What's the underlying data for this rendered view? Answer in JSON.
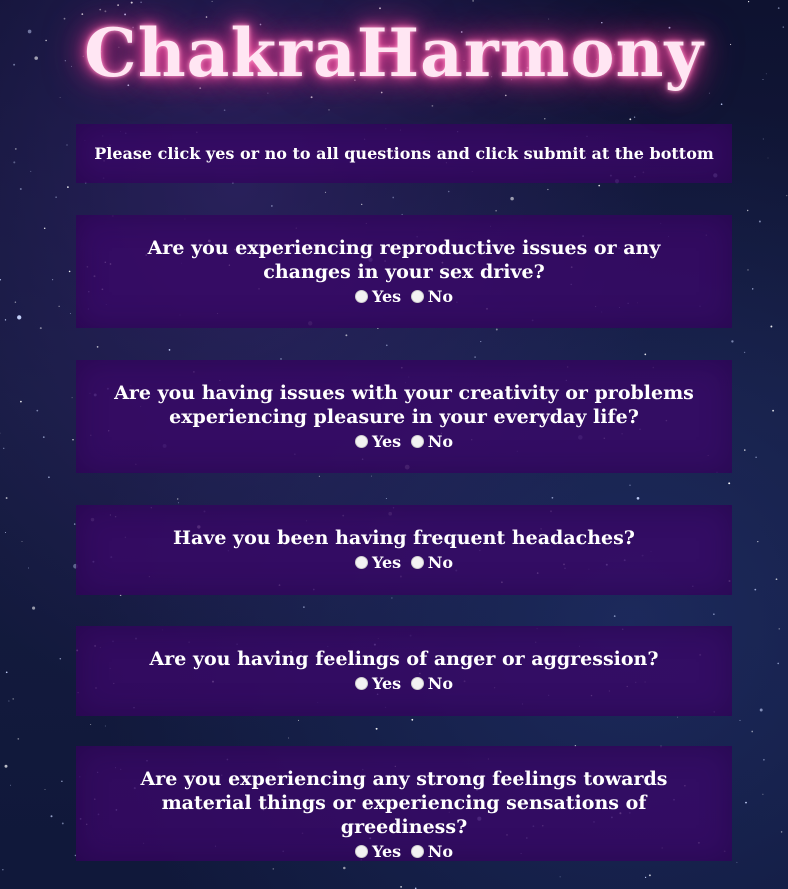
{
  "app": {
    "title": "ChakraHarmony",
    "instructions": "Please click yes or no to all questions and click submit at the bottom"
  },
  "colors": {
    "panel": "#3a0868",
    "title_glow": "#ff5aa8",
    "background": "#10183a"
  },
  "questions": [
    {
      "text": "Are you experiencing reproductive issues or any changes in your sex drive?",
      "yes_label": "Yes",
      "no_label": "No",
      "selected": null
    },
    {
      "text": "Are you having issues with your creativity or problems experiencing pleasure in your everyday life?",
      "yes_label": "Yes",
      "no_label": "No",
      "selected": null
    },
    {
      "text": "Have you been having frequent headaches?",
      "yes_label": "Yes",
      "no_label": "No",
      "selected": null
    },
    {
      "text": "Are you having feelings of anger or aggression?",
      "yes_label": "Yes",
      "no_label": "No",
      "selected": null
    },
    {
      "text": "Are you experiencing any strong feelings towards material things or experiencing sensations of greediness?",
      "yes_label": "Yes",
      "no_label": "No",
      "selected": null
    }
  ]
}
